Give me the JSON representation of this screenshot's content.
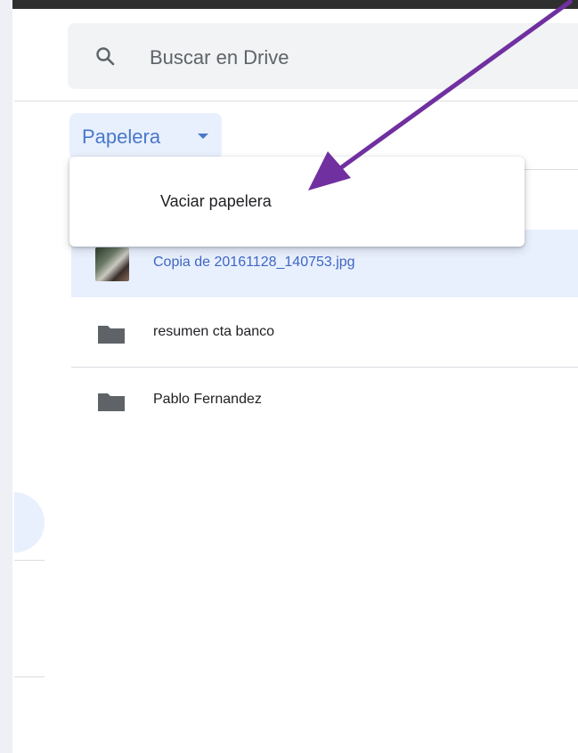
{
  "search": {
    "placeholder": "Buscar en Drive",
    "icon": "search-icon"
  },
  "location_button": {
    "label": "Papelera",
    "icon": "caret-down-icon"
  },
  "dropdown_menu": {
    "items": [
      {
        "label": "Vaciar papelera"
      }
    ]
  },
  "files": [
    {
      "name": "Copia de 20161128_140753.jpg",
      "type": "image",
      "selected": true
    },
    {
      "name": "resumen cta banco",
      "type": "folder",
      "selected": false
    },
    {
      "name": "Pablo Fernandez",
      "type": "folder",
      "selected": false
    }
  ],
  "annotation": {
    "arrow_color": "#7030a0"
  },
  "colors": {
    "accent": "#4a78c9",
    "selected_bg": "#e8f0fe",
    "search_bg": "#f1f3f4"
  }
}
